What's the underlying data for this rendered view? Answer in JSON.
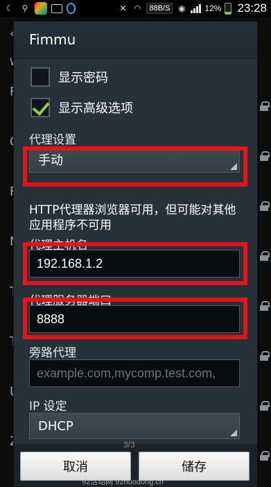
{
  "status_bar": {
    "speed": "88B/S",
    "battery": "12%",
    "time": "23:28"
  },
  "background_list": {
    "rows": [
      "F",
      "C",
      "F",
      "M",
      "T",
      "T",
      "U",
      "Z"
    ],
    "top_letter": "W"
  },
  "dialog": {
    "title": "Fimmu",
    "show_password": {
      "label": "显示密码",
      "checked": false
    },
    "show_advanced": {
      "label": "显示高级选项",
      "checked": true
    },
    "proxy_settings": {
      "label": "代理设置",
      "value": "手动"
    },
    "warning": "HTTP代理器浏览器可用，但可能对其他应用程序不可用",
    "proxy_host": {
      "label": "代理主机名",
      "value": "192.168.1.2"
    },
    "proxy_port": {
      "label": "代理服务器端口",
      "value": "8888"
    },
    "bypass": {
      "label": "旁路代理",
      "placeholder": "example.com,mycomp.test.com,"
    },
    "ip_settings": {
      "label": "IP 设定",
      "value": "DHCP"
    },
    "page_indicator": "3/3",
    "cancel_label": "取消",
    "save_label": "储存"
  },
  "watermark": "92活动网 92huodong.cn",
  "colors": {
    "highlight_red": "#e8121b",
    "check_green": "#8fd14a",
    "dialog_bg": "#26323a"
  }
}
